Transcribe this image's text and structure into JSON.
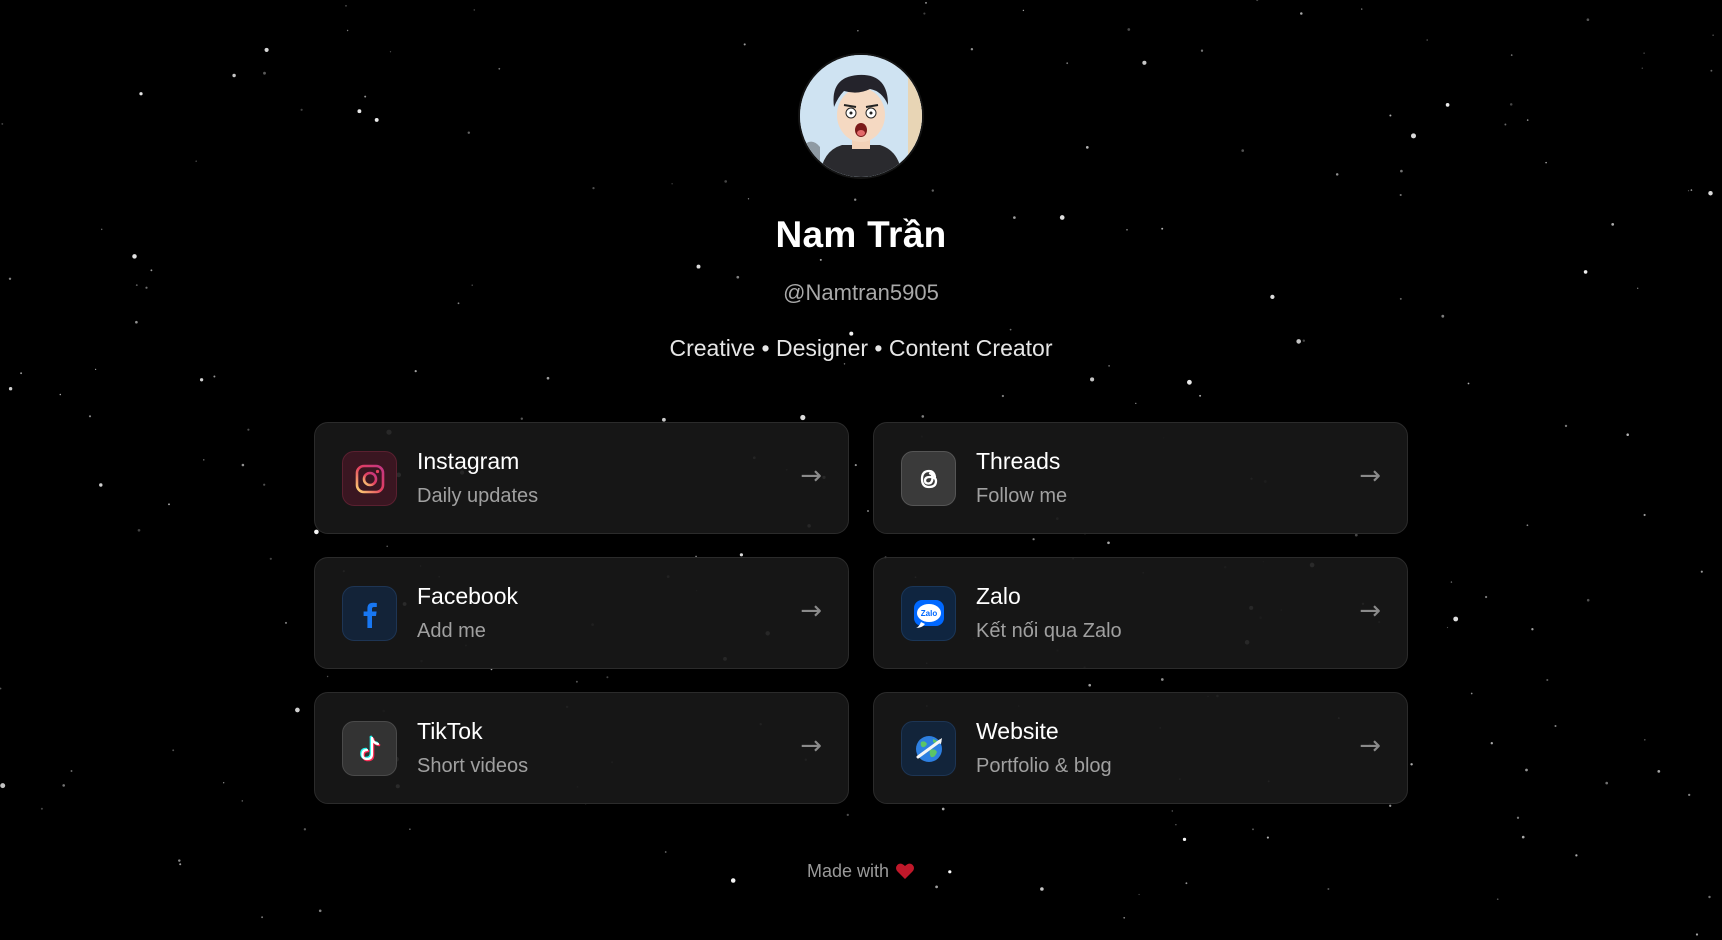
{
  "profile": {
    "name": "Nam Trần",
    "handle": "@Namtran5905",
    "bio": "Creative • Designer • Content Creator"
  },
  "links": [
    {
      "title": "Instagram",
      "subtitle": "Daily updates",
      "icon": "instagram-icon",
      "color": "#e4405f"
    },
    {
      "title": "Threads",
      "subtitle": "Follow me",
      "icon": "threads-icon",
      "color": "#ffffff"
    },
    {
      "title": "Facebook",
      "subtitle": "Add me",
      "icon": "facebook-icon",
      "color": "#1877f2"
    },
    {
      "title": "Zalo",
      "subtitle": "Kết nối qua Zalo",
      "icon": "zalo-icon",
      "color": "#0068ff"
    },
    {
      "title": "TikTok",
      "subtitle": "Short videos",
      "icon": "tiktok-icon",
      "color": "#25f4ee"
    },
    {
      "title": "Website",
      "subtitle": "Portfolio & blog",
      "icon": "globe-icon",
      "color": "#3b82f6"
    }
  ],
  "arrow": "→",
  "footer": {
    "text": "Made with",
    "icon": "heart-icon",
    "heart_color": "#c0182a"
  },
  "zalo_logo_text": "Zalo"
}
